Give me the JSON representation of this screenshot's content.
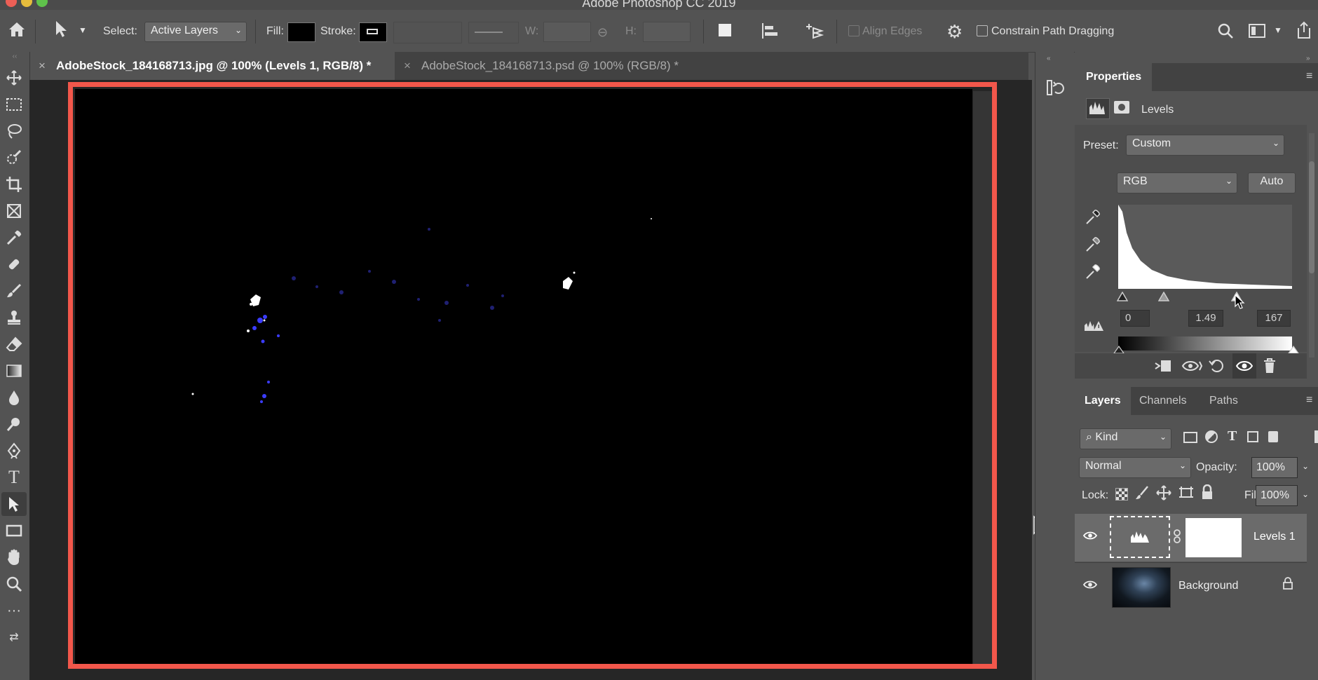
{
  "app": {
    "title": "Adobe Photoshop CC 2019"
  },
  "options_bar": {
    "select_label": "Select:",
    "select_value": "Active Layers",
    "fill_label": "Fill:",
    "stroke_label": "Stroke:",
    "w_label": "W:",
    "h_label": "H:",
    "align_edges_label": "Align Edges",
    "constrain_label": "Constrain Path Dragging",
    "fill_color": "#000000"
  },
  "tabs": [
    {
      "title": "AdobeStock_184168713.jpg @ 100% (Levels 1, RGB/8) *",
      "active": true
    },
    {
      "title": "AdobeStock_184168713.psd @ 100% (RGB/8) *",
      "active": false
    }
  ],
  "toolbar": {
    "icons": [
      "move-icon",
      "marquee-icon",
      "lasso-icon",
      "quick-selection-icon",
      "crop-icon",
      "frame-icon",
      "eyedropper-icon",
      "healing-brush-icon",
      "brush-icon",
      "clone-stamp-icon",
      "eraser-icon",
      "gradient-icon",
      "blur-icon",
      "dodge-icon",
      "pen-icon",
      "type-icon",
      "path-selection-icon",
      "rectangle-icon",
      "hand-icon",
      "zoom-icon",
      "more-tools-icon",
      "swap-colors-icon"
    ],
    "type_glyph": "T"
  },
  "properties": {
    "tab": "Properties",
    "adjustment": "Levels",
    "preset_label": "Preset:",
    "preset_value": "Custom",
    "channel_value": "RGB",
    "auto_button": "Auto",
    "input_black": "0",
    "input_gamma": "1.49",
    "input_white": "167",
    "input_levels": {
      "black": 0,
      "gamma": 1.49,
      "white": 167
    }
  },
  "layers_panel": {
    "tabs": [
      "Layers",
      "Channels",
      "Paths"
    ],
    "filter_value": "Kind",
    "blend_mode": "Normal",
    "opacity_label": "Opacity:",
    "opacity_value": "100%",
    "lock_label": "Lock:",
    "fill_label": "Fill:",
    "fill_value": "100%",
    "layers": [
      {
        "name": "Levels 1",
        "selected": true
      },
      {
        "name": "Background",
        "locked": true
      }
    ]
  }
}
